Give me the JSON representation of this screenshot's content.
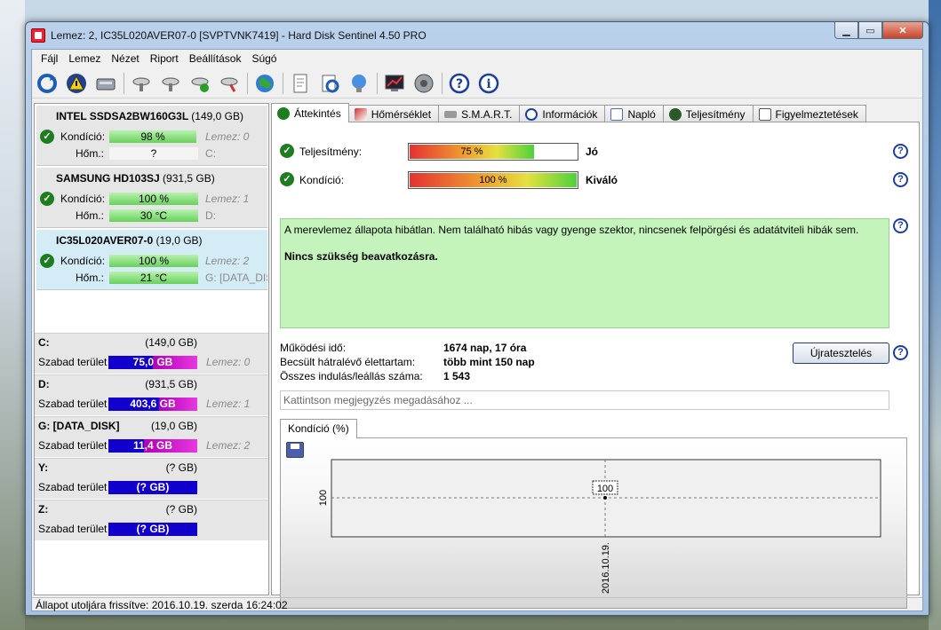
{
  "window": {
    "title": "Lemez: 2, IC35L020AVER07-0 [SVPTVNK7419]  -  Hard Disk Sentinel 4.50 PRO"
  },
  "menu": [
    "Fájl",
    "Lemez",
    "Nézet",
    "Riport",
    "Beállítások",
    "Súgó"
  ],
  "disks": [
    {
      "name": "INTEL SSDSA2BW160G3L",
      "size": "(149,0 GB)",
      "health_label": "Kondíció:",
      "health": "98 %",
      "health_pct": 98,
      "temp_label": "Hőm.:",
      "temp": "?",
      "sub1": "Lemez: 0",
      "sub2": "C:"
    },
    {
      "name": "SAMSUNG HD103SJ",
      "size": "(931,5 GB)",
      "health_label": "Kondíció:",
      "health": "100 %",
      "health_pct": 100,
      "temp_label": "Hőm.:",
      "temp": "30 °C",
      "sub1": "Lemez: 1",
      "sub2": "D:"
    },
    {
      "name": "IC35L020AVER07-0",
      "size": "(19,0 GB)",
      "health_label": "Kondíció:",
      "health": "100 %",
      "health_pct": 100,
      "temp_label": "Hőm.:",
      "temp": "21 °C",
      "sub1": "Lemez: 2",
      "sub2": "G: [DATA_DISK]"
    }
  ],
  "volumes": [
    {
      "name": "C:",
      "size": "(149,0 GB)",
      "free_label": "Szabad terület",
      "free": "75,0 GB",
      "used_pct": 50,
      "sub": "Lemez: 0"
    },
    {
      "name": "D:",
      "size": "(931,5 GB)",
      "free_label": "Szabad terület",
      "free": "403,6 GB",
      "used_pct": 57,
      "sub": "Lemez: 1"
    },
    {
      "name": "G: [DATA_DISK]",
      "size": "(19,0 GB)",
      "free_label": "Szabad terület",
      "free": "11,4 GB",
      "used_pct": 40,
      "sub": "Lemez: 2"
    },
    {
      "name": "Y:",
      "size": "(? GB)",
      "free_label": "Szabad terület",
      "free": "(? GB)",
      "used_pct": 0,
      "sub": ""
    },
    {
      "name": "Z:",
      "size": "(? GB)",
      "free_label": "Szabad terület",
      "free": "(? GB)",
      "used_pct": 0,
      "sub": ""
    }
  ],
  "tabs": [
    "Áttekintés",
    "Hőmérséklet",
    "S.M.A.R.T.",
    "Információk",
    "Napló",
    "Teljesítmény",
    "Figyelmeztetések"
  ],
  "overview": {
    "performance_label": "Teljesítmény:",
    "performance_value": "75 %",
    "performance_pct": 75,
    "performance_word": "Jó",
    "health_label": "Kondíció:",
    "health_value": "100 %",
    "health_pct": 100,
    "health_word": "Kiváló",
    "message": "A merevlemez állapota hibátlan. Nem található hibás vagy gyenge szektor, nincsenek felpörgési és adatátviteli hibák sem.",
    "action": "Nincs szükség beavatkozásra.",
    "uptime_label": "Működési idő:",
    "uptime": "1674 nap, 17 óra",
    "lifetime_label": "Becsült hátralévő élettartam:",
    "lifetime": "több mint 150 nap",
    "starts_label": "Összes indulás/leállás száma:",
    "starts": "1 543",
    "retest_label": "Újratesztelés",
    "note_placeholder": "Kattintson megjegyzés megadásához ..."
  },
  "chart_tab": "Kondíció  (%)",
  "chart_data": {
    "type": "line",
    "x": [
      "2016.10.19."
    ],
    "values": [
      100
    ],
    "y_tick": "100",
    "point_label": "100"
  },
  "status": "Állapot utoljára frissítve: 2016.10.19. szerda 16:24:02",
  "colors": {
    "health_ok": "#6ad05c",
    "selected_disk": "#d4ecf6",
    "volume_free": "#1100cc",
    "volume_used": "#e838e0"
  }
}
